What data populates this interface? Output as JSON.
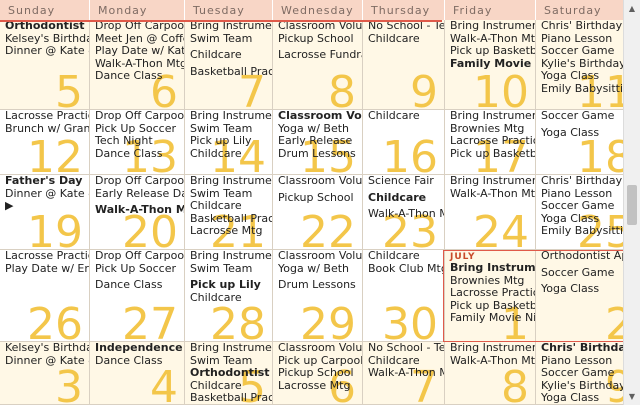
{
  "days": [
    "Sunday",
    "Monday",
    "Tuesday",
    "Wednesday",
    "Thursday",
    "Friday",
    "Saturday"
  ],
  "weeks": [
    {
      "cells": [
        {
          "day": "5",
          "events": [
            {
              "text": "Orthodontist",
              "bold": true
            },
            {
              "text": "Kelsey's Birthday"
            },
            {
              "text": "Dinner @ Kate & Bill's"
            }
          ]
        },
        {
          "day": "6",
          "events": [
            {
              "text": "Drop Off Carpool"
            },
            {
              "text": "Meet Jen @ Coffee"
            },
            {
              "text": "Play Date w/ Katie"
            },
            {
              "text": "Walk-A-Thon Mtg"
            },
            {
              "text": "Dance Class"
            }
          ]
        },
        {
          "day": "7",
          "events": [
            {
              "text": "Bring Instruments"
            },
            {
              "text": "Swim Team"
            },
            {
              "text": "Childcare",
              "gap": true
            },
            {
              "text": "Basketball Practice",
              "gap": true
            }
          ]
        },
        {
          "day": "8",
          "events": [
            {
              "text": "Classroom Volunteer"
            },
            {
              "text": "Pickup School"
            },
            {
              "text": "Lacrosse Fundraiser",
              "gap": true
            }
          ]
        },
        {
          "day": "9",
          "events": [
            {
              "text": "No School - Teacher"
            },
            {
              "text": "Childcare"
            }
          ]
        },
        {
          "day": "10",
          "events": [
            {
              "text": "Bring Instruments"
            },
            {
              "text": "Walk-A-Thon Mtg"
            },
            {
              "text": "Pick up Basketball"
            },
            {
              "text": "Family Movie Night",
              "bold": true
            }
          ]
        },
        {
          "day": "11",
          "events": [
            {
              "text": "Chris' Birthday Party"
            },
            {
              "text": "Piano Lesson"
            },
            {
              "text": "Soccer Game"
            },
            {
              "text": "Kylie's Birthday"
            },
            {
              "text": "Yoga Class"
            },
            {
              "text": "Emily Babysitting"
            }
          ]
        }
      ]
    },
    {
      "cells": [
        {
          "day": "12",
          "events": [
            {
              "text": "Lacrosse Practice"
            },
            {
              "text": "Brunch w/ Grandma"
            }
          ]
        },
        {
          "day": "13",
          "events": [
            {
              "text": "Drop Off Carpool"
            },
            {
              "text": "Pick Up Soccer"
            },
            {
              "text": "Tech Night"
            },
            {
              "text": "Dance Class"
            }
          ]
        },
        {
          "day": "14",
          "events": [
            {
              "text": "Bring Instruments"
            },
            {
              "text": "Swim Team"
            },
            {
              "text": "Pick up Lily"
            },
            {
              "text": "Childcare"
            }
          ]
        },
        {
          "day": "15",
          "events": [
            {
              "text": "Classroom Volunteer",
              "bold": true
            },
            {
              "text": "Yoga w/ Beth"
            },
            {
              "text": "Early Release"
            },
            {
              "text": "Drum Lessons"
            }
          ]
        },
        {
          "day": "16",
          "events": [
            {
              "text": "Childcare"
            }
          ]
        },
        {
          "day": "17",
          "events": [
            {
              "text": "Bring Instruments"
            },
            {
              "text": "Brownies Mtg"
            },
            {
              "text": "Lacrosse Practice"
            },
            {
              "text": "Pick up Basketball"
            }
          ]
        },
        {
          "day": "18",
          "events": [
            {
              "text": "Soccer Game"
            },
            {
              "text": "Yoga Class",
              "gap": true
            }
          ]
        }
      ]
    },
    {
      "cells": [
        {
          "day": "19",
          "events": [
            {
              "text": "Father's Day",
              "bold": true
            },
            {
              "text": "Dinner @ Kate & Bill's"
            },
            {
              "text": "▶"
            }
          ]
        },
        {
          "day": "20",
          "events": [
            {
              "text": "Drop Off Carpool"
            },
            {
              "text": "Early Release Day"
            },
            {
              "text": "Walk-A-Thon Mtg",
              "bold": true,
              "gap": true
            }
          ]
        },
        {
          "day": "21",
          "events": [
            {
              "text": "Bring Instruments"
            },
            {
              "text": "Swim Team"
            },
            {
              "text": "Childcare"
            },
            {
              "text": "Basketball Practice"
            },
            {
              "text": "Lacrosse Mtg"
            }
          ]
        },
        {
          "day": "22",
          "events": [
            {
              "text": "Classroom Volunteer"
            },
            {
              "text": "Pickup School",
              "gap": true
            }
          ]
        },
        {
          "day": "23",
          "events": [
            {
              "text": "Science Fair"
            },
            {
              "text": "Childcare",
              "bold": true,
              "gap": true
            },
            {
              "text": "Walk-A-Thon Mtg",
              "gap": true
            }
          ]
        },
        {
          "day": "24",
          "events": [
            {
              "text": "Bring Instruments"
            },
            {
              "text": "Walk-A-Thon Mtg"
            }
          ]
        },
        {
          "day": "25",
          "events": [
            {
              "text": "Chris' Birthday Party"
            },
            {
              "text": "Piano Lesson"
            },
            {
              "text": "Soccer Game"
            },
            {
              "text": "Yoga Class"
            },
            {
              "text": "Emily Babysitting"
            }
          ]
        }
      ]
    },
    {
      "cells": [
        {
          "day": "26",
          "events": [
            {
              "text": "Lacrosse Practice"
            },
            {
              "text": "Play Date w/ Eric"
            }
          ]
        },
        {
          "day": "27",
          "events": [
            {
              "text": "Drop Off Carpool"
            },
            {
              "text": "Pick Up Soccer"
            },
            {
              "text": "Dance Class",
              "gap": true
            }
          ]
        },
        {
          "day": "28",
          "events": [
            {
              "text": "Bring Instruments"
            },
            {
              "text": "Swim Team"
            },
            {
              "text": "Pick up Lily",
              "bold": true,
              "gap": true
            },
            {
              "text": "Childcare"
            }
          ]
        },
        {
          "day": "29",
          "events": [
            {
              "text": "Classroom Volunteer"
            },
            {
              "text": "Yoga w/ Beth"
            },
            {
              "text": "Drum Lessons",
              "gap": true
            }
          ]
        },
        {
          "day": "30",
          "events": [
            {
              "text": "Childcare"
            },
            {
              "text": "Book Club Mtg"
            }
          ]
        },
        {
          "day": "1",
          "month": "JULY",
          "events": [
            {
              "text": "Bring Instruments",
              "bold": true
            },
            {
              "text": "Brownies Mtg"
            },
            {
              "text": "Lacrosse Practice"
            },
            {
              "text": "Pick up Basketball"
            },
            {
              "text": "Family Movie Night"
            }
          ]
        },
        {
          "day": "2",
          "events": [
            {
              "text": "Orthodontist Appt"
            },
            {
              "text": "Soccer Game",
              "gap": true
            },
            {
              "text": "Yoga Class",
              "gap": true
            }
          ]
        }
      ]
    },
    {
      "cells": [
        {
          "day": "3",
          "events": [
            {
              "text": "Kelsey's Birthday"
            },
            {
              "text": "Dinner @ Kate & Bill's"
            }
          ]
        },
        {
          "day": "4",
          "events": [
            {
              "text": "Independence Day",
              "bold": true
            },
            {
              "text": "Dance Class"
            }
          ]
        },
        {
          "day": "5",
          "events": [
            {
              "text": "Bring Instruments"
            },
            {
              "text": "Swim Team"
            },
            {
              "text": "Orthodontist",
              "bold": true
            },
            {
              "text": "Childcare"
            },
            {
              "text": "Basketball Practice"
            }
          ]
        },
        {
          "day": "6",
          "events": [
            {
              "text": "Classroom Volunteer"
            },
            {
              "text": "Pick up Carpool"
            },
            {
              "text": "Pickup School"
            },
            {
              "text": "Lacrosse Mtg"
            }
          ]
        },
        {
          "day": "7",
          "events": [
            {
              "text": "No School - Teacher"
            },
            {
              "text": "Childcare"
            },
            {
              "text": "Walk-A-Thon Mtg"
            }
          ]
        },
        {
          "day": "8",
          "events": [
            {
              "text": "Bring Instruments"
            },
            {
              "text": "Walk-A-Thon Mtg"
            }
          ]
        },
        {
          "day": "9",
          "events": [
            {
              "text": "Chris' Birthday",
              "bold": true
            },
            {
              "text": "Piano Lesson"
            },
            {
              "text": "Soccer Game"
            },
            {
              "text": "Kylie's Birthday"
            },
            {
              "text": "Yoga Class"
            }
          ]
        }
      ]
    }
  ],
  "scrollbar": {
    "up_icon": "triangle-up",
    "down_icon": "triangle-down"
  },
  "colors": {
    "header_bg": "#f8d6c6",
    "day_number": "#f3c64a",
    "highlight": "#e05a4a",
    "month_label": "#c84a2a"
  }
}
